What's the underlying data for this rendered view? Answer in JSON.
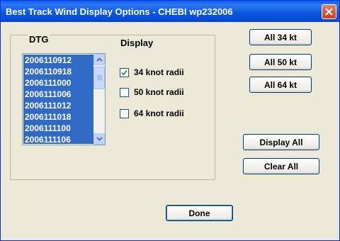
{
  "window": {
    "title": "Best Track Wind Display Options - CHEBI wp232006"
  },
  "dtg": {
    "label": "DTG",
    "items": [
      "2006110912",
      "2006110918",
      "2006111000",
      "2006111006",
      "2006111012",
      "2006111018",
      "2006111100",
      "2006111106"
    ],
    "selected_all_visible": true
  },
  "display": {
    "label": "Display",
    "options": [
      {
        "label": "34 knot radii",
        "checked": true
      },
      {
        "label": "50 knot radii",
        "checked": false
      },
      {
        "label": "64 knot radii",
        "checked": false
      }
    ]
  },
  "buttons": {
    "all34": "All 34 kt",
    "all50": "All 50 kt",
    "all64": "All 64 kt",
    "display_all": "Display All",
    "clear_all": "Clear All",
    "done": "Done"
  },
  "colors": {
    "titlebar": "#0A56E0",
    "selection": "#316AC5",
    "dialog_bg": "#ECE9D8"
  },
  "icons": {
    "close": "close-icon",
    "scroll_up": "scroll-up-arrow-icon",
    "scroll_down": "scroll-down-arrow-icon",
    "check": "checkmark-icon"
  }
}
